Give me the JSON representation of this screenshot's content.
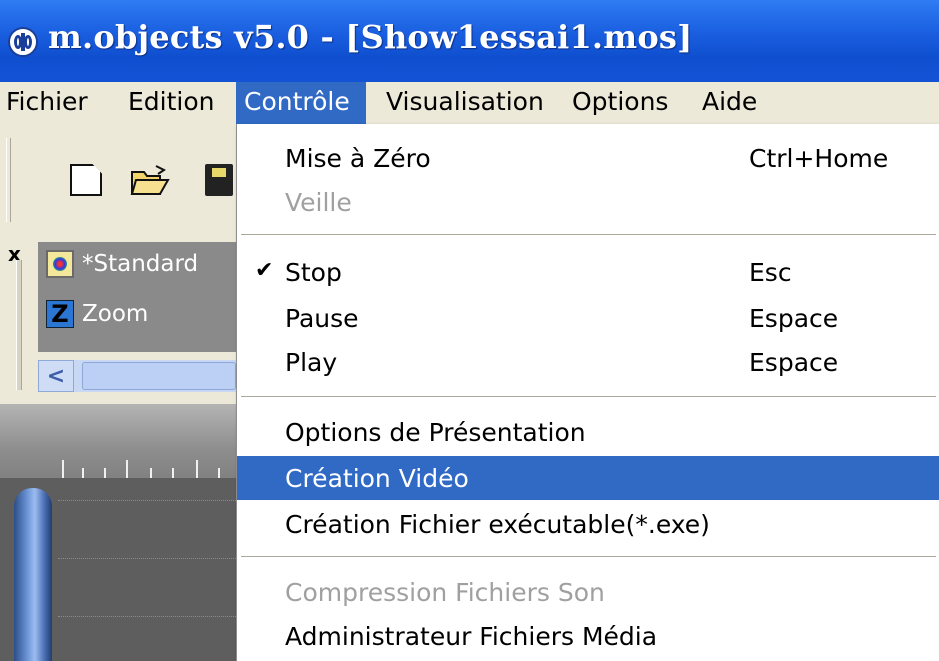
{
  "window": {
    "title": "m.objects v5.0 - [Show1essai1.mos]"
  },
  "menubar": {
    "items": [
      {
        "label": "Fichier"
      },
      {
        "label": "Edition"
      },
      {
        "label": "Contrôle"
      },
      {
        "label": "Visualisation"
      },
      {
        "label": "Options"
      },
      {
        "label": "Aide"
      }
    ]
  },
  "panel": {
    "close_label": "x",
    "items": [
      {
        "label": "*Standard",
        "icon": "standard-icon"
      },
      {
        "label": "Zoom",
        "icon": "zoom-icon",
        "icon_letter": "Z"
      }
    ],
    "scroll_left_glyph": "<"
  },
  "dropdown": {
    "items": [
      {
        "label": "Mise à Zéro",
        "shortcut": "Ctrl+Home"
      },
      {
        "label": "Veille",
        "shortcut": ""
      },
      {
        "label": "Stop",
        "shortcut": "Esc"
      },
      {
        "label": "Pause",
        "shortcut": "Espace"
      },
      {
        "label": "Play",
        "shortcut": "Espace"
      },
      {
        "label": "Options de Présentation",
        "shortcut": ""
      },
      {
        "label": "Création Vidéo",
        "shortcut": ""
      },
      {
        "label": "Création Fichier exécutable(*.exe)",
        "shortcut": ""
      },
      {
        "label": "Compression Fichiers Son",
        "shortcut": ""
      },
      {
        "label": "Administrateur Fichiers Média",
        "shortcut": ""
      }
    ],
    "check_glyph": "✔"
  },
  "colors": {
    "title_bar": "#1a5fe0",
    "menu_highlight": "#316ac5",
    "disabled_text": "#a0a0a0"
  }
}
